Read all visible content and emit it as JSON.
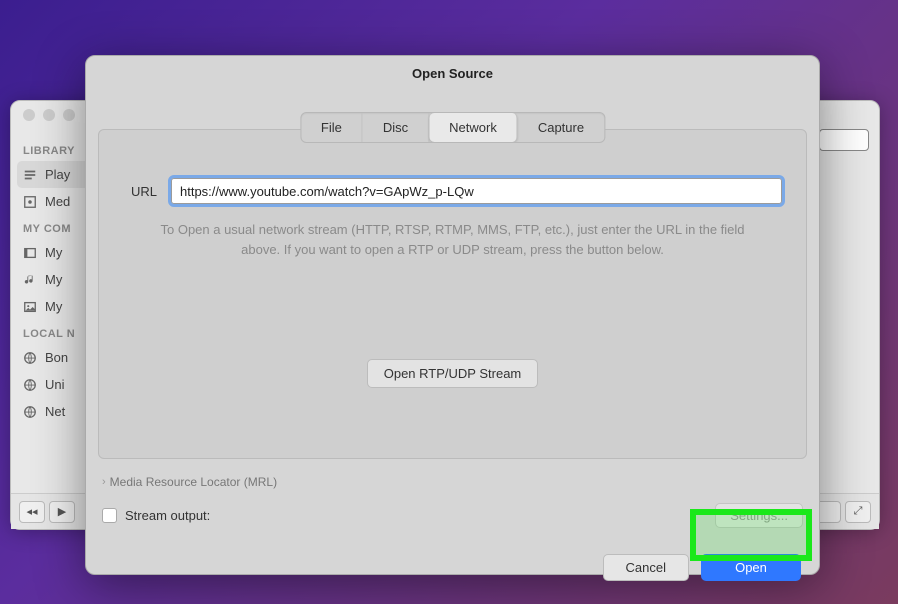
{
  "sidebar": {
    "section1": "LIBRARY",
    "items1": [
      {
        "label": "Play"
      },
      {
        "label": "Med"
      }
    ],
    "section2": "MY COM",
    "items2": [
      {
        "label": "My"
      },
      {
        "label": "My"
      },
      {
        "label": "My"
      }
    ],
    "section3": "LOCAL N",
    "items3": [
      {
        "label": "Bon"
      },
      {
        "label": "Uni"
      },
      {
        "label": "Net"
      }
    ]
  },
  "dialog": {
    "title": "Open Source",
    "tabs": {
      "file": "File",
      "disc": "Disc",
      "network": "Network",
      "capture": "Capture"
    },
    "url_label": "URL",
    "url_value": "https://www.youtube.com/watch?v=GApWz_p-LQw",
    "help_text": "To Open a usual network stream (HTTP, RTSP, RTMP, MMS, FTP, etc.), just enter the URL in the field above. If you want to open a RTP or UDP stream, press the button below.",
    "rtp_button": "Open RTP/UDP Stream",
    "mrl_label": "Media Resource Locator (MRL)",
    "stream_output_label": "Stream output:",
    "settings_label": "Settings...",
    "cancel_label": "Cancel",
    "open_label": "Open"
  }
}
